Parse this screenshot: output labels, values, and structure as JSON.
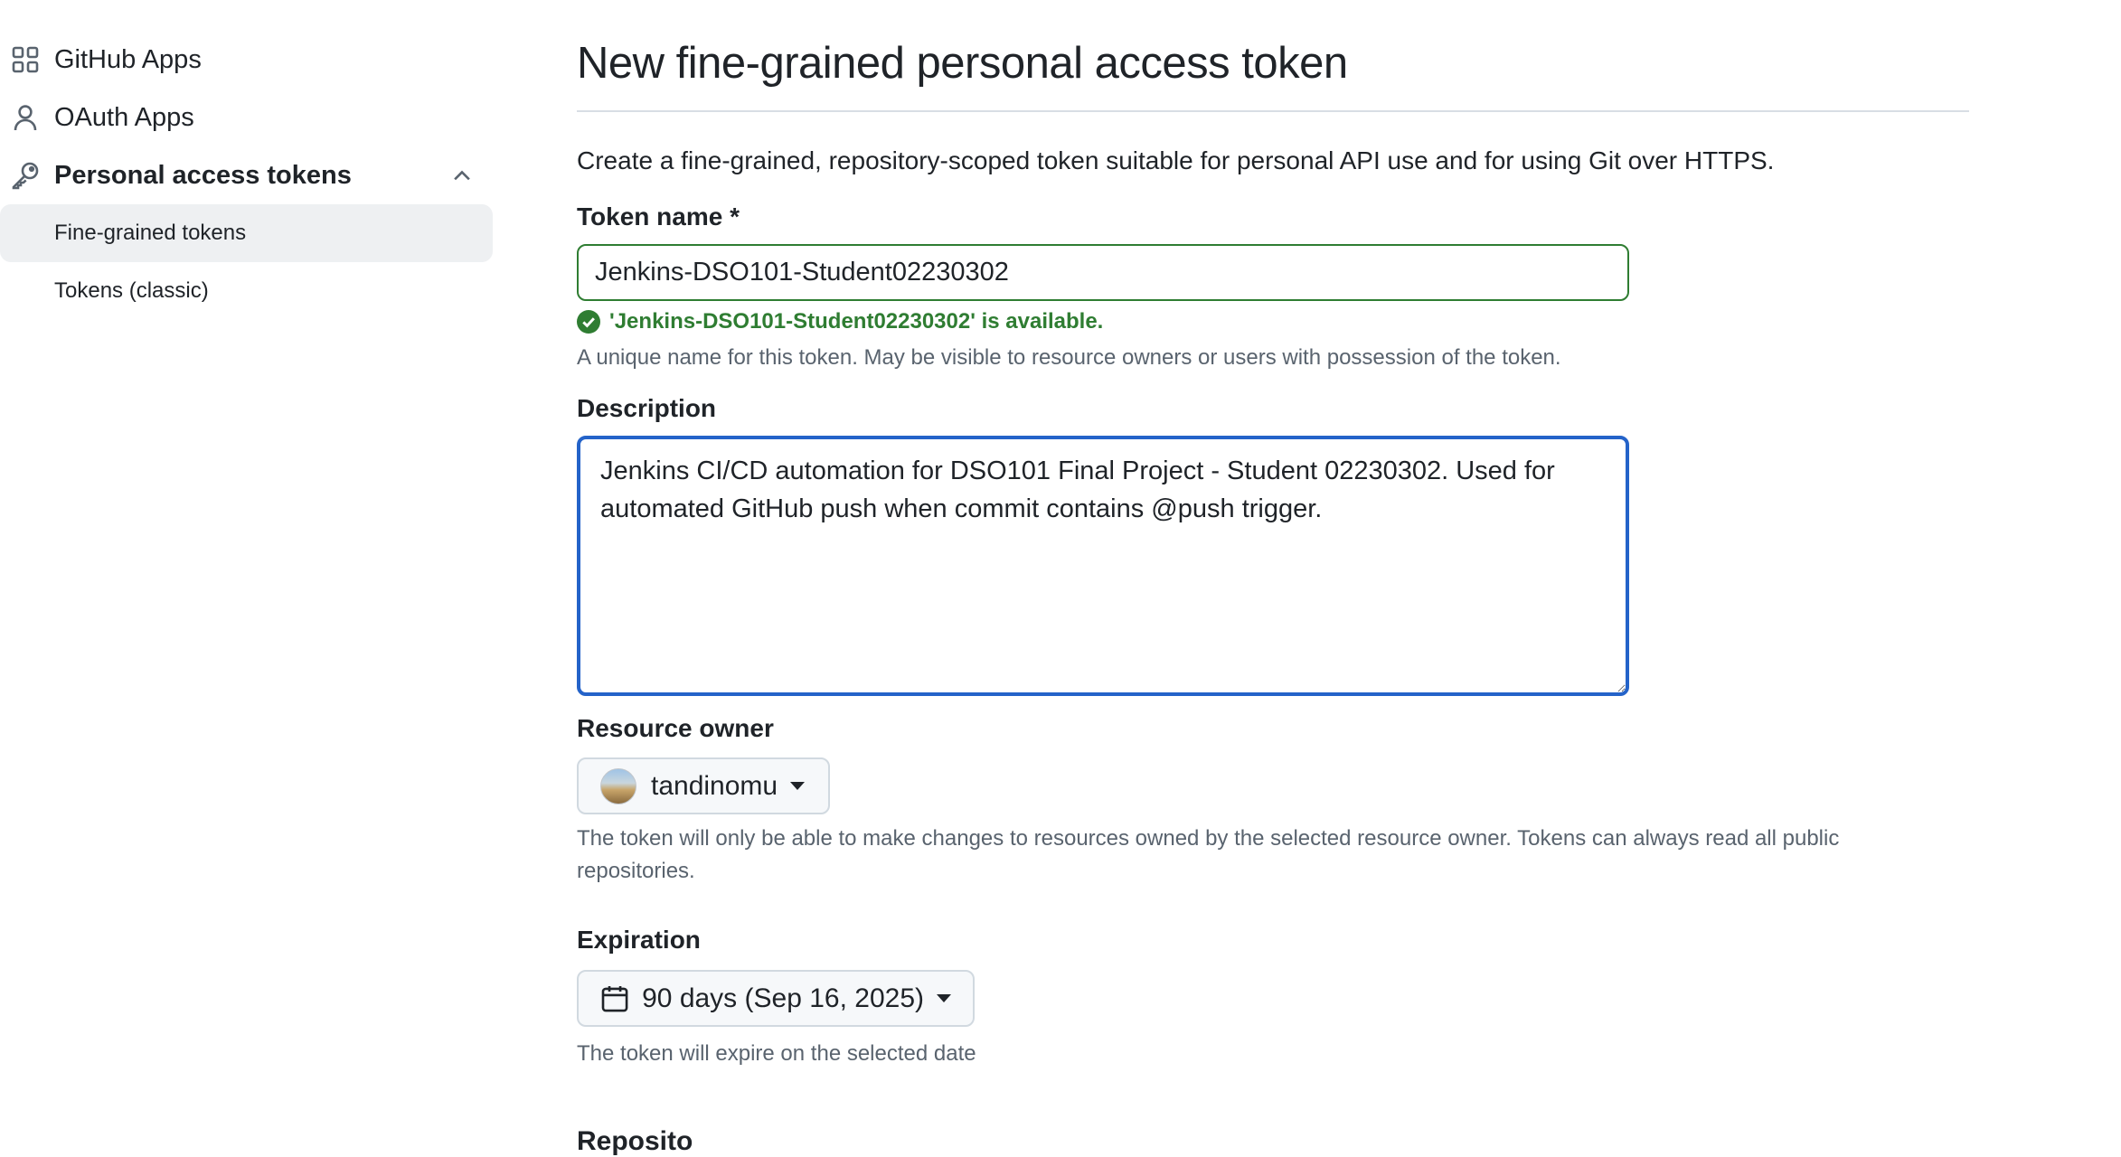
{
  "sidebar": {
    "items": [
      {
        "label": "GitHub Apps",
        "icon": "apps-grid-icon"
      },
      {
        "label": "OAuth Apps",
        "icon": "person-icon"
      },
      {
        "label": "Personal access tokens",
        "icon": "key-icon",
        "expanded": true
      }
    ],
    "sub_items": [
      {
        "label": "Fine-grained tokens",
        "active": true
      },
      {
        "label": "Tokens (classic)",
        "active": false
      }
    ]
  },
  "main": {
    "title": "New fine-grained personal access token",
    "intro": "Create a fine-grained, repository-scoped token suitable for personal API use and for using Git over HTTPS.",
    "token_name": {
      "label": "Token name *",
      "value": "Jenkins-DSO101-Student02230302",
      "valid_message": "'Jenkins-DSO101-Student02230302' is available.",
      "hint": "A unique name for this token. May be visible to resource owners or users with possession of the token."
    },
    "description": {
      "label": "Description",
      "value": "Jenkins CI/CD automation for DSO101 Final Project - Student 02230302. Used for automated GitHub push when commit contains @push trigger."
    },
    "resource_owner": {
      "label": "Resource owner",
      "selected": "tandinomu",
      "hint": "The token will only be able to make changes to resources owned by the selected resource owner. Tokens can always read all public repositories."
    },
    "expiration": {
      "label": "Expiration",
      "selected": "90 days (Sep 16, 2025)",
      "hint": "The token will expire on the selected date"
    },
    "next_section_heading": "Reposito"
  },
  "colors": {
    "success": "#2f7d32",
    "focus": "#2463c9",
    "muted_text": "#59636e",
    "active_bg": "#eef0f2"
  }
}
